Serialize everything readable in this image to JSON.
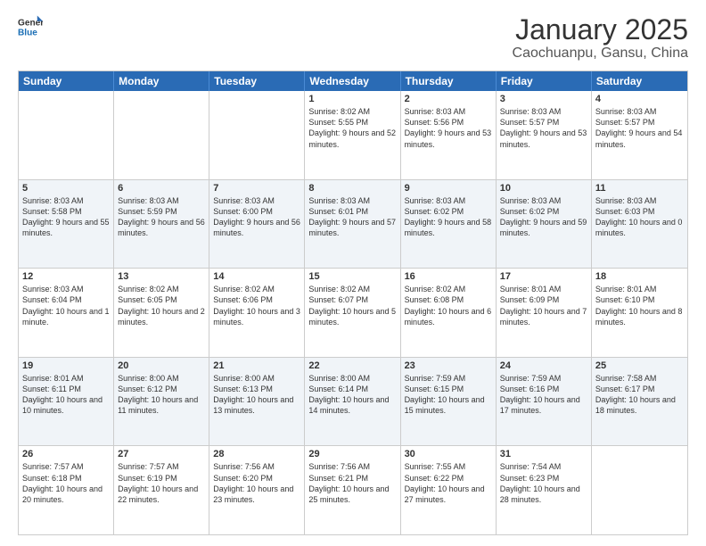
{
  "logo": {
    "general": "General",
    "blue": "Blue"
  },
  "title": "January 2025",
  "subtitle": "Caochuanpu, Gansu, China",
  "days": [
    "Sunday",
    "Monday",
    "Tuesday",
    "Wednesday",
    "Thursday",
    "Friday",
    "Saturday"
  ],
  "weeks": [
    [
      {
        "num": "",
        "text": "",
        "empty": true
      },
      {
        "num": "",
        "text": "",
        "empty": true
      },
      {
        "num": "",
        "text": "",
        "empty": true
      },
      {
        "num": "1",
        "text": "Sunrise: 8:02 AM\nSunset: 5:55 PM\nDaylight: 9 hours and 52 minutes."
      },
      {
        "num": "2",
        "text": "Sunrise: 8:03 AM\nSunset: 5:56 PM\nDaylight: 9 hours and 53 minutes."
      },
      {
        "num": "3",
        "text": "Sunrise: 8:03 AM\nSunset: 5:57 PM\nDaylight: 9 hours and 53 minutes."
      },
      {
        "num": "4",
        "text": "Sunrise: 8:03 AM\nSunset: 5:57 PM\nDaylight: 9 hours and 54 minutes."
      }
    ],
    [
      {
        "num": "5",
        "text": "Sunrise: 8:03 AM\nSunset: 5:58 PM\nDaylight: 9 hours and 55 minutes."
      },
      {
        "num": "6",
        "text": "Sunrise: 8:03 AM\nSunset: 5:59 PM\nDaylight: 9 hours and 56 minutes."
      },
      {
        "num": "7",
        "text": "Sunrise: 8:03 AM\nSunset: 6:00 PM\nDaylight: 9 hours and 56 minutes."
      },
      {
        "num": "8",
        "text": "Sunrise: 8:03 AM\nSunset: 6:01 PM\nDaylight: 9 hours and 57 minutes."
      },
      {
        "num": "9",
        "text": "Sunrise: 8:03 AM\nSunset: 6:02 PM\nDaylight: 9 hours and 58 minutes."
      },
      {
        "num": "10",
        "text": "Sunrise: 8:03 AM\nSunset: 6:02 PM\nDaylight: 9 hours and 59 minutes."
      },
      {
        "num": "11",
        "text": "Sunrise: 8:03 AM\nSunset: 6:03 PM\nDaylight: 10 hours and 0 minutes."
      }
    ],
    [
      {
        "num": "12",
        "text": "Sunrise: 8:03 AM\nSunset: 6:04 PM\nDaylight: 10 hours and 1 minute."
      },
      {
        "num": "13",
        "text": "Sunrise: 8:02 AM\nSunset: 6:05 PM\nDaylight: 10 hours and 2 minutes."
      },
      {
        "num": "14",
        "text": "Sunrise: 8:02 AM\nSunset: 6:06 PM\nDaylight: 10 hours and 3 minutes."
      },
      {
        "num": "15",
        "text": "Sunrise: 8:02 AM\nSunset: 6:07 PM\nDaylight: 10 hours and 5 minutes."
      },
      {
        "num": "16",
        "text": "Sunrise: 8:02 AM\nSunset: 6:08 PM\nDaylight: 10 hours and 6 minutes."
      },
      {
        "num": "17",
        "text": "Sunrise: 8:01 AM\nSunset: 6:09 PM\nDaylight: 10 hours and 7 minutes."
      },
      {
        "num": "18",
        "text": "Sunrise: 8:01 AM\nSunset: 6:10 PM\nDaylight: 10 hours and 8 minutes."
      }
    ],
    [
      {
        "num": "19",
        "text": "Sunrise: 8:01 AM\nSunset: 6:11 PM\nDaylight: 10 hours and 10 minutes."
      },
      {
        "num": "20",
        "text": "Sunrise: 8:00 AM\nSunset: 6:12 PM\nDaylight: 10 hours and 11 minutes."
      },
      {
        "num": "21",
        "text": "Sunrise: 8:00 AM\nSunset: 6:13 PM\nDaylight: 10 hours and 13 minutes."
      },
      {
        "num": "22",
        "text": "Sunrise: 8:00 AM\nSunset: 6:14 PM\nDaylight: 10 hours and 14 minutes."
      },
      {
        "num": "23",
        "text": "Sunrise: 7:59 AM\nSunset: 6:15 PM\nDaylight: 10 hours and 15 minutes."
      },
      {
        "num": "24",
        "text": "Sunrise: 7:59 AM\nSunset: 6:16 PM\nDaylight: 10 hours and 17 minutes."
      },
      {
        "num": "25",
        "text": "Sunrise: 7:58 AM\nSunset: 6:17 PM\nDaylight: 10 hours and 18 minutes."
      }
    ],
    [
      {
        "num": "26",
        "text": "Sunrise: 7:57 AM\nSunset: 6:18 PM\nDaylight: 10 hours and 20 minutes."
      },
      {
        "num": "27",
        "text": "Sunrise: 7:57 AM\nSunset: 6:19 PM\nDaylight: 10 hours and 22 minutes."
      },
      {
        "num": "28",
        "text": "Sunrise: 7:56 AM\nSunset: 6:20 PM\nDaylight: 10 hours and 23 minutes."
      },
      {
        "num": "29",
        "text": "Sunrise: 7:56 AM\nSunset: 6:21 PM\nDaylight: 10 hours and 25 minutes."
      },
      {
        "num": "30",
        "text": "Sunrise: 7:55 AM\nSunset: 6:22 PM\nDaylight: 10 hours and 27 minutes."
      },
      {
        "num": "31",
        "text": "Sunrise: 7:54 AM\nSunset: 6:23 PM\nDaylight: 10 hours and 28 minutes."
      },
      {
        "num": "",
        "text": "",
        "empty": true
      }
    ]
  ]
}
